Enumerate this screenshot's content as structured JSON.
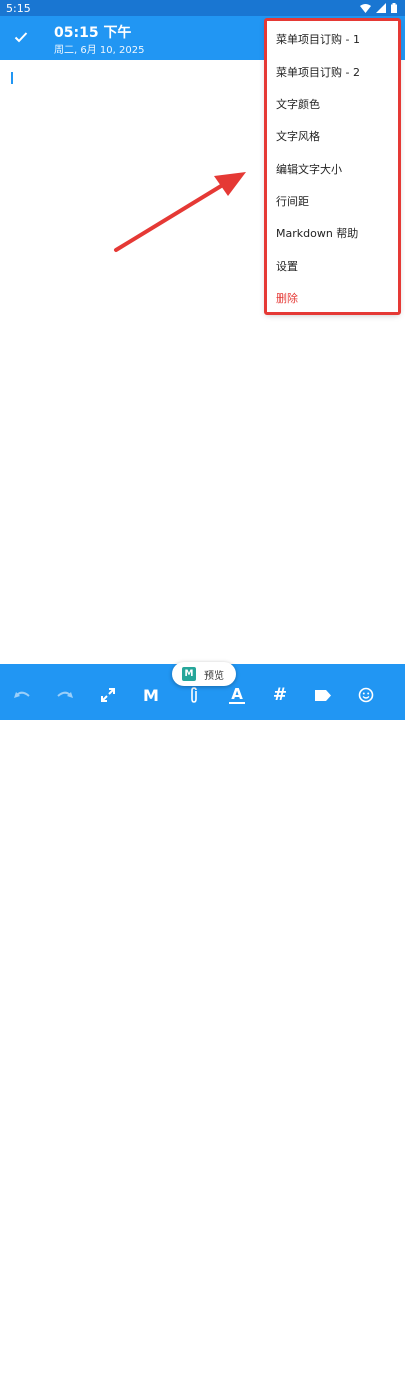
{
  "status_bar": {
    "time": "5:15",
    "icons": [
      "wifi-icon",
      "signal-icon",
      "battery-icon"
    ]
  },
  "header": {
    "title": "05:15 下午",
    "subtitle": "周二, 6月 10, 2025"
  },
  "menu": {
    "items": [
      {
        "label": "菜单项目订购 - 1"
      },
      {
        "label": "菜单项目订购 - 2"
      },
      {
        "label": "文字颜色"
      },
      {
        "label": "文字风格"
      },
      {
        "label": "编辑文字大小"
      },
      {
        "label": "行间距"
      },
      {
        "label": "Markdown 帮助"
      },
      {
        "label": "设置"
      },
      {
        "label": "删除"
      }
    ]
  },
  "toolbar": {
    "icons": [
      "undo-icon",
      "redo-icon",
      "fullscreen-icon",
      "markdown-icon",
      "attach-icon",
      "text-format-icon",
      "hashtag-icon",
      "label-icon",
      "emoji-icon"
    ],
    "markdown_label": "M",
    "hashtag_label": "#",
    "text_label": "A"
  },
  "preview": {
    "badge": "M",
    "label": "预览"
  },
  "colors": {
    "primary": "#2196F3",
    "status_bar": "#1976D2",
    "highlight": "#e53935",
    "delete": "#e53935"
  }
}
